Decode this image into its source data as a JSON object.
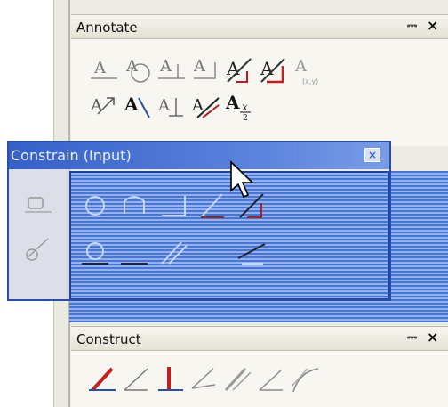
{
  "annotate": {
    "title": "Annotate",
    "pin": "I",
    "close": "×"
  },
  "construct": {
    "title": "Construct",
    "pin": "I",
    "close": "×"
  },
  "float_window": {
    "title": "Constrain (Input)",
    "close": "×"
  },
  "annotate_tools_row1": [
    "text-label-icon",
    "circle-text-icon",
    "align-text-icon",
    "angle-text-icon",
    "angled-slash-text-icon",
    "angled-red-text-icon",
    "coordinate-text-icon"
  ],
  "annotate_tools_row2": [
    "arrow-label-icon",
    "bold-leader-icon",
    "plain-leader-icon",
    "crossed-leader-icon",
    "fraction-text-icon"
  ],
  "annotate_text": {
    "coord_label": "(x,y)",
    "fraction_label": "A",
    "fraction_sub": "x",
    "fraction_den": "2"
  },
  "construct_tools": [
    "red-pen-icon",
    "angle-line-icon",
    "perpendicular-red-icon",
    "angle-arrows-icon",
    "parallel-lines-icon",
    "angle-line-2-icon",
    "curve-tangent-icon"
  ],
  "colors": {
    "accent": "#3560c8",
    "panel": "#f7f6f0",
    "header": "#ecebe3"
  }
}
